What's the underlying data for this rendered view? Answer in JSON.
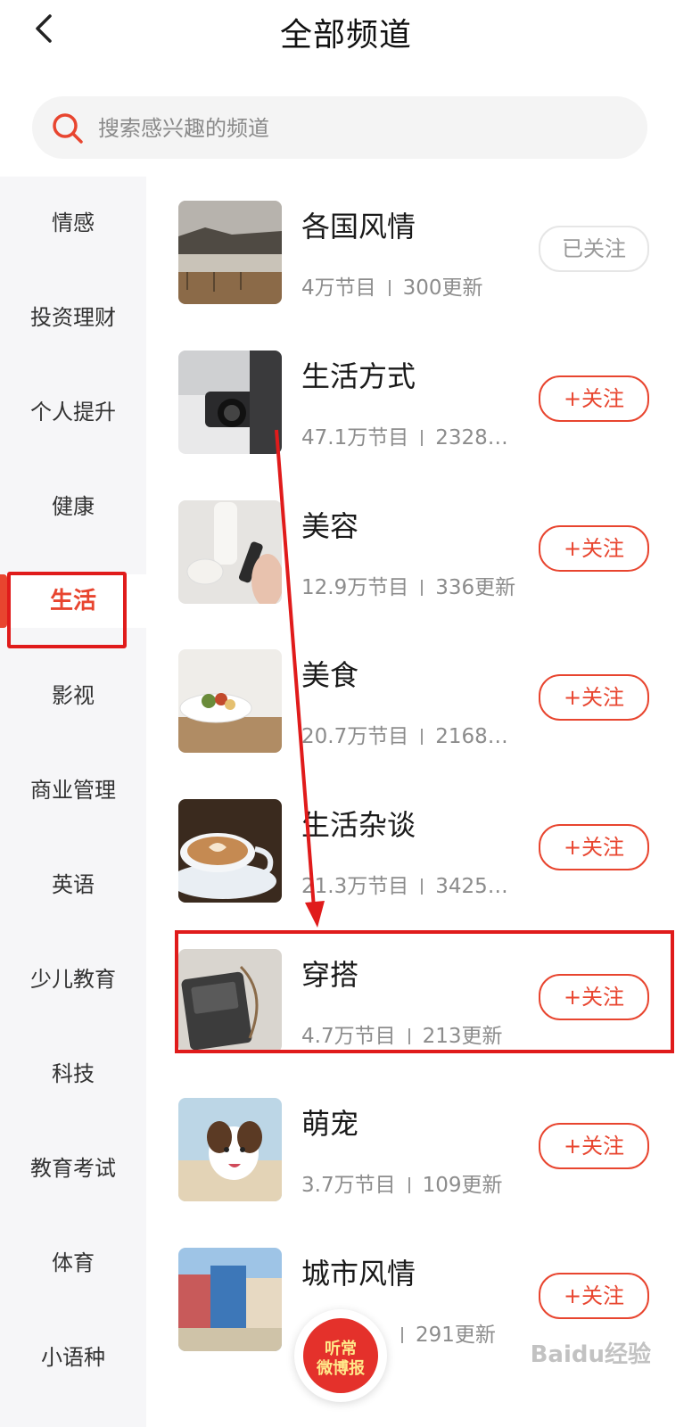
{
  "header": {
    "title": "全部频道"
  },
  "search": {
    "placeholder": "搜索感兴趣的频道"
  },
  "sidebar": {
    "items": [
      {
        "label": "情感"
      },
      {
        "label": "投资理财"
      },
      {
        "label": "个人提升"
      },
      {
        "label": "健康"
      },
      {
        "label": "生活",
        "active": true
      },
      {
        "label": "影视"
      },
      {
        "label": "商业管理"
      },
      {
        "label": "英语"
      },
      {
        "label": "少儿教育"
      },
      {
        "label": "科技"
      },
      {
        "label": "教育考试"
      },
      {
        "label": "体育"
      },
      {
        "label": "小语种"
      }
    ]
  },
  "channels": [
    {
      "name": "各国风情",
      "programs": "4万节目",
      "updates": "300更新",
      "button": "已关注",
      "followed": true
    },
    {
      "name": "生活方式",
      "programs": "47.1万节目",
      "updates": "2328…",
      "button": "+关注"
    },
    {
      "name": "美容",
      "programs": "12.9万节目",
      "updates": "336更新",
      "button": "+关注"
    },
    {
      "name": "美食",
      "programs": "20.7万节目",
      "updates": "2168…",
      "button": "+关注"
    },
    {
      "name": "生活杂谈",
      "programs": "21.3万节目",
      "updates": "3425…",
      "button": "+关注"
    },
    {
      "name": "穿搭",
      "programs": "4.7万节目",
      "updates": "213更新",
      "button": "+关注"
    },
    {
      "name": "萌宠",
      "programs": "3.7万节目",
      "updates": "109更新",
      "button": "+关注"
    },
    {
      "name": "城市风情",
      "programs": "",
      "updates": "291更新",
      "button": "+关注"
    }
  ],
  "float_player": {
    "line1": "听常",
    "line2": "微博报"
  },
  "watermark": "Baidu经验",
  "colors": {
    "accent": "#e8452f",
    "annotation": "#e01b1b"
  }
}
